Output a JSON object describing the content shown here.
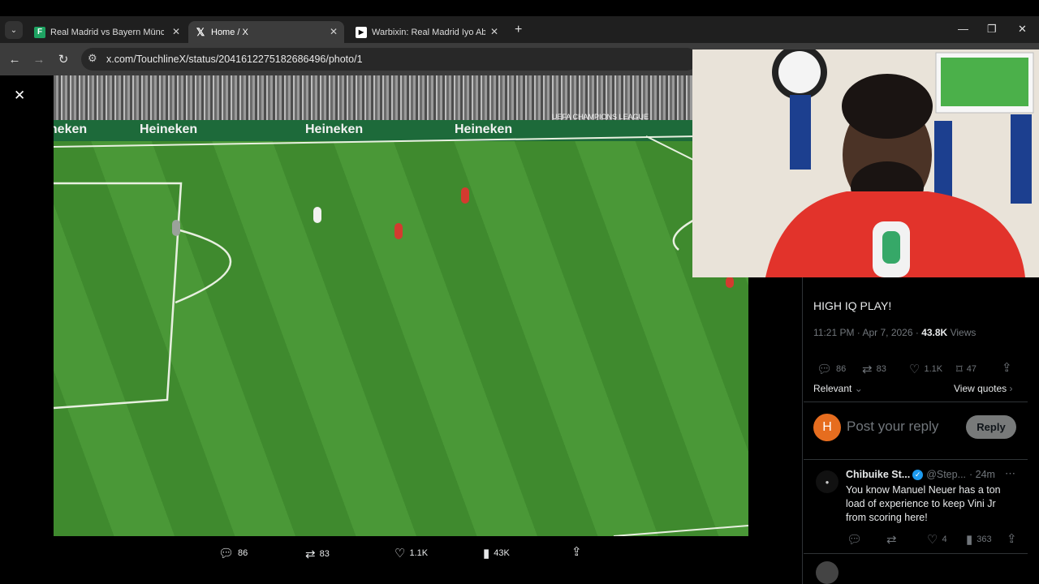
{
  "browser": {
    "tabs": [
      {
        "label": "Real Madrid vs Bayern München",
        "favicon": "f-icon",
        "color": "#1ea362",
        "active": false
      },
      {
        "label": "Home / X",
        "favicon": "x-icon",
        "color": "#000000",
        "active": true
      },
      {
        "label": "Warbixin: Real Madrid Iyo Abbo",
        "favicon": "play-icon",
        "color": "#ffffff",
        "active": false
      }
    ],
    "new_tab": "+",
    "url": "x.com/TouchlineX/status/2041612275182686496/photo/1"
  },
  "viewer": {
    "close": "✕",
    "ads": [
      "Heineken",
      "Heineken",
      "Heineken",
      "Heineken"
    ],
    "ucl": "UEFA CHAMPIONS LEAGUE",
    "bottom_bar": {
      "replies": "86",
      "reposts": "83",
      "likes": "1.1K",
      "views": "43K"
    }
  },
  "tweet": {
    "text": "HIGH IQ PLAY!",
    "time": "11:21 PM · Apr 7, 2026 ·",
    "views_count": "43.8K",
    "views_label": "Views",
    "replies": "86",
    "reposts": "83",
    "likes": "1.1K",
    "bookmarks": "47",
    "sort": "Relevant",
    "view_quotes": "View quotes"
  },
  "composer": {
    "avatar_letter": "H",
    "placeholder": "Post your reply",
    "reply_button": "Reply"
  },
  "reply": {
    "name": "Chibuike St...",
    "handle": "@Step...",
    "time": "· 24m",
    "text": "You know Manuel Neuer has a ton load of experience to keep Vini Jr from scoring here!",
    "replies": "",
    "reposts": "",
    "likes": "4",
    "views": "363"
  },
  "colors": {
    "accent": "#1d9bf0",
    "avatar": "#e66d1f",
    "pitch": "#4a9837"
  }
}
